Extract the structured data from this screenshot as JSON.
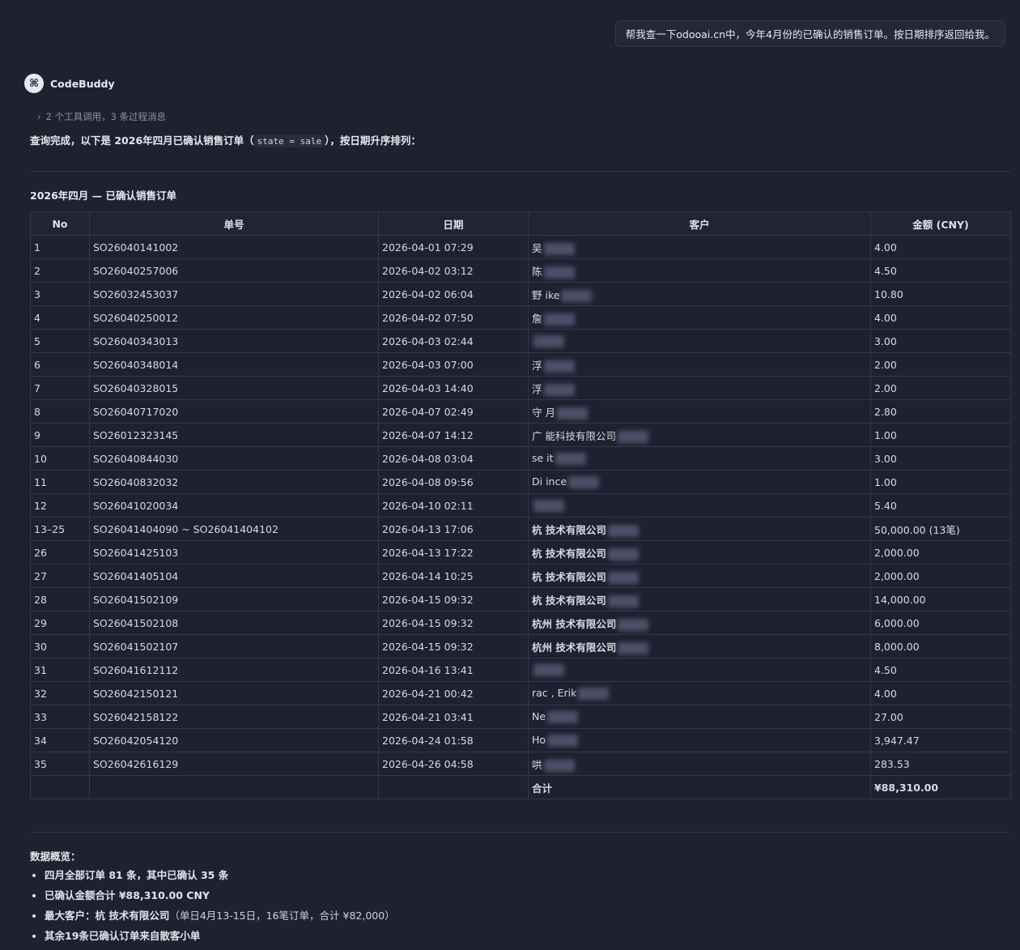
{
  "user_message": "帮我查一下odooai.cn中，今年4月份的已确认的销售订单。按日期排序返回给我。",
  "bot": {
    "name": "CodeBuddy",
    "avatar_icon": "codebuddy-logo-icon"
  },
  "tool_summary": {
    "chevron": "›",
    "text": "2 个工具调用，3 条过程消息"
  },
  "intro": {
    "prefix": "查询完成，以下是 2026年四月已确认销售订单（",
    "code": "state = sale",
    "suffix": "），按日期升序排列："
  },
  "table": {
    "title": "2026年四月 — 已确认销售订单",
    "headers": [
      "No",
      "单号",
      "日期",
      "客户",
      "金额 (CNY)"
    ],
    "rows": [
      {
        "no": "1",
        "order": "SO26040141002",
        "date": "2026-04-01 07:29",
        "customer": "吴",
        "amount": "4.00"
      },
      {
        "no": "2",
        "order": "SO26040257006",
        "date": "2026-04-02 03:12",
        "customer": "陈",
        "amount": "4.50"
      },
      {
        "no": "3",
        "order": "SO26032453037",
        "date": "2026-04-02 06:04",
        "customer": "野 ike",
        "amount": "10.80"
      },
      {
        "no": "4",
        "order": "SO26040250012",
        "date": "2026-04-02 07:50",
        "customer": "詹",
        "amount": "4.00"
      },
      {
        "no": "5",
        "order": "SO26040343013",
        "date": "2026-04-03 02:44",
        "customer": "",
        "amount": "3.00"
      },
      {
        "no": "6",
        "order": "SO26040348014",
        "date": "2026-04-03 07:00",
        "customer": "浮",
        "amount": "2.00"
      },
      {
        "no": "7",
        "order": "SO26040328015",
        "date": "2026-04-03 14:40",
        "customer": "浮",
        "amount": "2.00"
      },
      {
        "no": "8",
        "order": "SO26040717020",
        "date": "2026-04-07 02:49",
        "customer": "守 月",
        "amount": "2.80"
      },
      {
        "no": "9",
        "order": "SO26012323145",
        "date": "2026-04-07 14:12",
        "customer": "广 能科技有限公司",
        "amount": "1.00"
      },
      {
        "no": "10",
        "order": "SO26040844030",
        "date": "2026-04-08 03:04",
        "customer": "se it",
        "amount": "3.00"
      },
      {
        "no": "11",
        "order": "SO26040832032",
        "date": "2026-04-08 09:56",
        "customer": "Di ince",
        "amount": "1.00"
      },
      {
        "no": "12",
        "order": "SO26041020034",
        "date": "2026-04-10 02:11",
        "customer": "",
        "amount": "5.40"
      },
      {
        "no": "13–25",
        "order": "SO26041404090 ~ SO26041404102",
        "date": "2026-04-13 17:06",
        "customer": "杭 技术有限公司",
        "amount": "50,000.00 (13笔)",
        "bold": true
      },
      {
        "no": "26",
        "order": "SO26041425103",
        "date": "2026-04-13 17:22",
        "customer": "杭 技术有限公司",
        "amount": "2,000.00",
        "bold": true
      },
      {
        "no": "27",
        "order": "SO26041405104",
        "date": "2026-04-14 10:25",
        "customer": "杭 技术有限公司",
        "amount": "2,000.00",
        "bold": true
      },
      {
        "no": "28",
        "order": "SO26041502109",
        "date": "2026-04-15 09:32",
        "customer": "杭 技术有限公司",
        "amount": "14,000.00",
        "bold": true
      },
      {
        "no": "29",
        "order": "SO26041502108",
        "date": "2026-04-15 09:32",
        "customer": "杭州 技术有限公司",
        "amount": "6,000.00",
        "bold": true
      },
      {
        "no": "30",
        "order": "SO26041502107",
        "date": "2026-04-15 09:32",
        "customer": "杭州 技术有限公司",
        "amount": "8,000.00",
        "bold": true
      },
      {
        "no": "31",
        "order": "SO26041612112",
        "date": "2026-04-16 13:41",
        "customer": "",
        "amount": "4.50"
      },
      {
        "no": "32",
        "order": "SO26042150121",
        "date": "2026-04-21 00:42",
        "customer": "rac , Erik",
        "amount": "4.00"
      },
      {
        "no": "33",
        "order": "SO26042158122",
        "date": "2026-04-21 03:41",
        "customer": "Ne",
        "amount": "27.00"
      },
      {
        "no": "34",
        "order": "SO26042054120",
        "date": "2026-04-24 01:58",
        "customer": "Ho",
        "amount": "3,947.47"
      },
      {
        "no": "35",
        "order": "SO26042616129",
        "date": "2026-04-26 04:58",
        "customer": "哄",
        "amount": "283.53"
      }
    ],
    "total": {
      "label": "合计",
      "amount": "¥88,310.00"
    }
  },
  "summary": {
    "title": "数据概览：",
    "items": [
      {
        "text": "四月全部订单 81 条，其中已确认 35 条"
      },
      {
        "text": "已确认金额合计 ¥88,310.00 CNY"
      },
      {
        "text": "最大客户：杭 技术有限公司",
        "note": "（单日4月13-15日，16笔订单，合计 ¥82,000）"
      },
      {
        "text": "其余19条已确认订单来自散客小单"
      }
    ]
  }
}
